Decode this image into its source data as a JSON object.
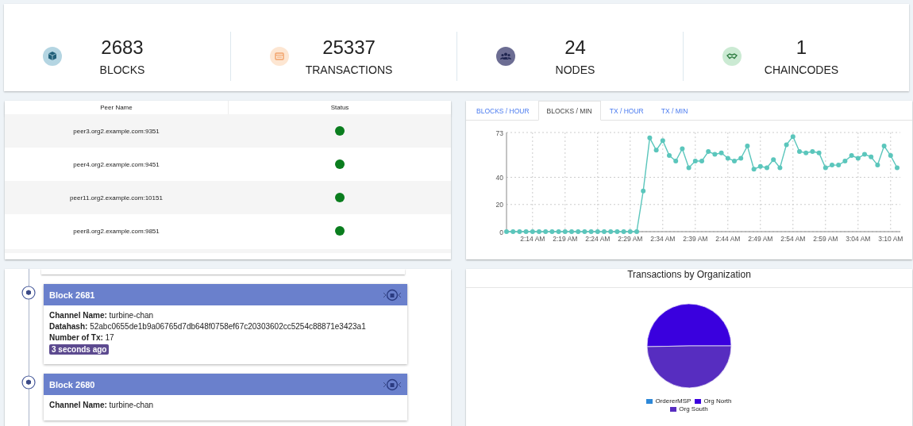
{
  "stats": [
    {
      "kind": "blocks",
      "value": "2683",
      "label": "BLOCKS"
    },
    {
      "kind": "transactions",
      "value": "25337",
      "label": "TRANSACTIONS"
    },
    {
      "kind": "nodes",
      "value": "24",
      "label": "NODES"
    },
    {
      "kind": "chaincodes",
      "value": "1",
      "label": "CHAINCODES"
    }
  ],
  "peers": {
    "columns": [
      "Peer Name",
      "Status"
    ],
    "rows": [
      {
        "name": "peer3.org2.example.com:9351",
        "color": "#0a7d1e"
      },
      {
        "name": "peer4.org2.example.com:9451",
        "color": "#0a7d1e"
      },
      {
        "name": "peer11.org2.example.com:10151",
        "color": "#0a7d1e"
      },
      {
        "name": "peer8.org2.example.com:9851",
        "color": "#0a7d1e"
      }
    ]
  },
  "activity": {
    "tabs": [
      {
        "label": "BLOCKS / HOUR",
        "selected": false
      },
      {
        "label": "BLOCKS / MIN",
        "selected": true
      },
      {
        "label": "TX / HOUR",
        "selected": false
      },
      {
        "label": "TX / MIN",
        "selected": false
      }
    ],
    "chart_data": {
      "type": "line",
      "categories": [
        null,
        null,
        null,
        null,
        "2:14 AM",
        null,
        null,
        null,
        null,
        "2:19 AM",
        null,
        null,
        null,
        null,
        "2:24 AM",
        null,
        null,
        null,
        null,
        "2:29 AM",
        null,
        null,
        null,
        null,
        "2:34 AM",
        null,
        null,
        null,
        null,
        "2:39 AM",
        null,
        null,
        null,
        null,
        "2:44 AM",
        null,
        null,
        null,
        null,
        "2:49 AM",
        null,
        null,
        null,
        null,
        "2:54 AM",
        null,
        null,
        null,
        null,
        "2:59 AM",
        null,
        null,
        null,
        null,
        "3:04 AM",
        null,
        null,
        null,
        null,
        "3:10 AM",
        null
      ],
      "grid": true,
      "series": [
        {
          "color": "#5bc6bc",
          "marker": true,
          "values": [
            0,
            0,
            0,
            0,
            0,
            0,
            0,
            0,
            0,
            0,
            0,
            0,
            0,
            0,
            0,
            0,
            0,
            0,
            0,
            0,
            0,
            30,
            69,
            60,
            67,
            56,
            52,
            61,
            47,
            52,
            52,
            59,
            57,
            58,
            54,
            52,
            54,
            63,
            46,
            48,
            47,
            53,
            47,
            64,
            70,
            59,
            58,
            59,
            58,
            47,
            49,
            49,
            52,
            56,
            54,
            57,
            55,
            49,
            63,
            56,
            47
          ]
        }
      ],
      "ylim": [
        0,
        73
      ],
      "yticks": [
        0,
        20,
        40,
        73
      ]
    }
  },
  "blocks": [
    {
      "title": "Block 2681",
      "lines": [
        "**Channel Name:** turbine-chan",
        "**Datahash:** 52abc0655de1b9a06765d7db648f0758ef67c20303602cc5254c88871e3423a1",
        "**Number of Tx:** 17"
      ],
      "age": "3 seconds ago"
    },
    {
      "title": "Block 2680",
      "lines": [
        "**Channel Name:** turbine-chan"
      ]
    }
  ],
  "org_chart": {
    "title": "Transactions by Organization",
    "chart_data": {
      "type": "pie",
      "categories": [
        "OrdererMSP",
        "Org North",
        "Org South"
      ],
      "values": [
        0,
        50.3,
        49.7
      ],
      "colors": [
        "#2d88d8",
        "#3a00de",
        "#572dc0"
      ]
    }
  }
}
